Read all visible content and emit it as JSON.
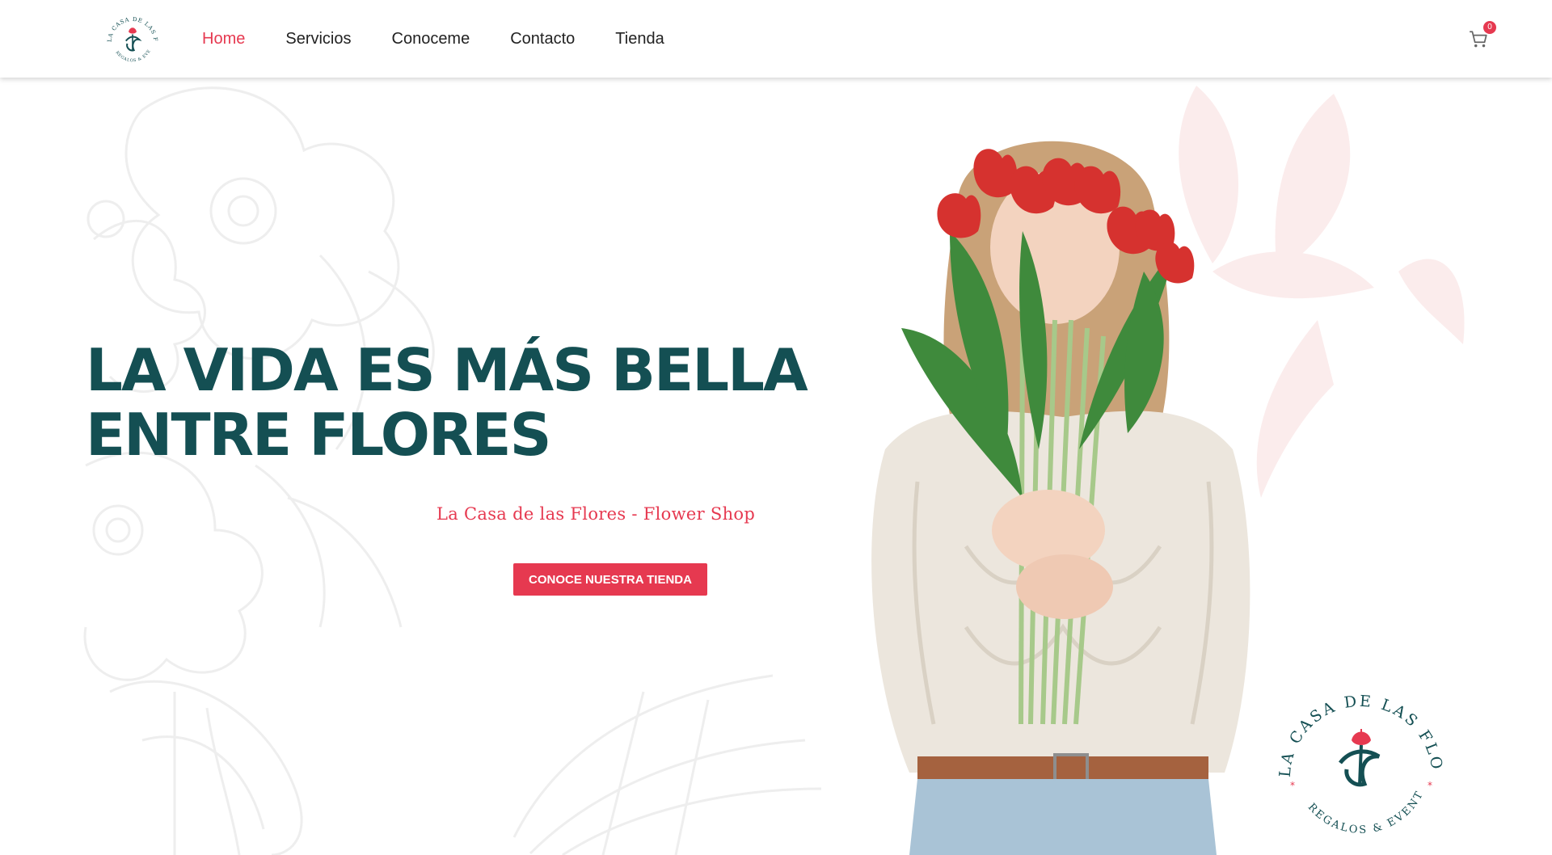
{
  "brand": {
    "logo_alt": "La Casa de las Flores logo",
    "logo_ring_top": "LA CASA DE LAS FLORES",
    "logo_ring_bottom": "REGALOS & EVENTOS"
  },
  "nav": {
    "items": [
      {
        "label": "Home",
        "active": true
      },
      {
        "label": "Servicios",
        "active": false
      },
      {
        "label": "Conoceme",
        "active": false
      },
      {
        "label": "Contacto",
        "active": false
      },
      {
        "label": "Tienda",
        "active": false
      }
    ]
  },
  "cart": {
    "icon": "cart-icon",
    "count": "0"
  },
  "hero": {
    "headline_line1": "LA VIDA ES MÁS BELLA",
    "headline_line2": "ENTRE FLORES",
    "subtitle": "La Casa de las Flores - Flower Shop",
    "cta_label": "CONOCE NUESTRA TIENDA"
  },
  "colors": {
    "accent": "#e63950",
    "headline": "#144f53",
    "logo_teal": "#144f53"
  }
}
